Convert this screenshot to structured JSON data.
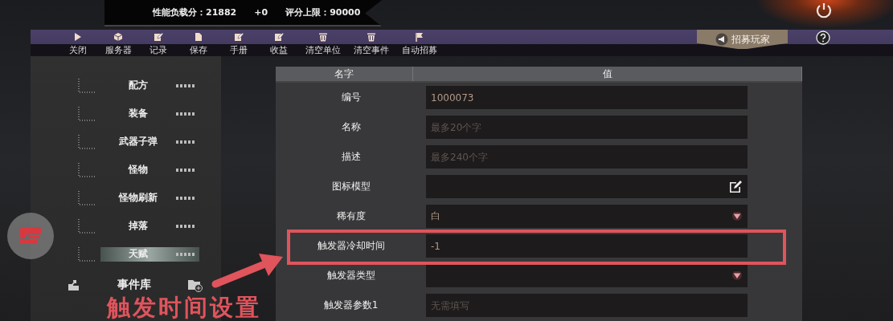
{
  "score_banner": {
    "load_label": "性能负载分：21882",
    "delta": "+0",
    "limit_label": "评分上限：90000"
  },
  "toolbar": [
    {
      "label": "关闭",
      "kind": "play"
    },
    {
      "label": "服务器",
      "kind": "cube"
    },
    {
      "label": "记录",
      "kind": "edit"
    },
    {
      "label": "保存",
      "kind": "doc"
    },
    {
      "label": "手册",
      "kind": "edit"
    },
    {
      "label": "收益",
      "kind": "edit"
    },
    {
      "label": "清空单位",
      "kind": "trash"
    },
    {
      "label": "清空事件",
      "kind": "trash"
    },
    {
      "label": "自动招募",
      "kind": "flag"
    }
  ],
  "recruit_button": {
    "label": "招募玩家"
  },
  "sidebar": {
    "items": [
      {
        "label": "配方",
        "selected": false
      },
      {
        "label": "装备",
        "selected": false
      },
      {
        "label": "武器子弹",
        "selected": false
      },
      {
        "label": "怪物",
        "selected": false
      },
      {
        "label": "怪物刷新",
        "selected": false
      },
      {
        "label": "掉落",
        "selected": false
      },
      {
        "label": "天赋",
        "selected": true
      }
    ],
    "footer": {
      "label": "事件库"
    }
  },
  "table": {
    "columns": [
      "名字",
      "值"
    ],
    "rows": [
      {
        "label": "编号",
        "kind": "text",
        "value": "1000073"
      },
      {
        "label": "名称",
        "kind": "text",
        "placeholder": "最多20个字"
      },
      {
        "label": "描述",
        "kind": "text",
        "placeholder": "最多240个字"
      },
      {
        "label": "图标模型",
        "kind": "edit"
      },
      {
        "label": "稀有度",
        "kind": "select",
        "value": "白"
      },
      {
        "label": "触发器冷却时间",
        "kind": "text",
        "value": "-1",
        "highlighted": true
      },
      {
        "label": "触发器类型",
        "kind": "select"
      },
      {
        "label": "触发器参数1",
        "kind": "text",
        "placeholder": "无需填写"
      }
    ]
  },
  "annotation": {
    "caption": "触发时间设置"
  }
}
